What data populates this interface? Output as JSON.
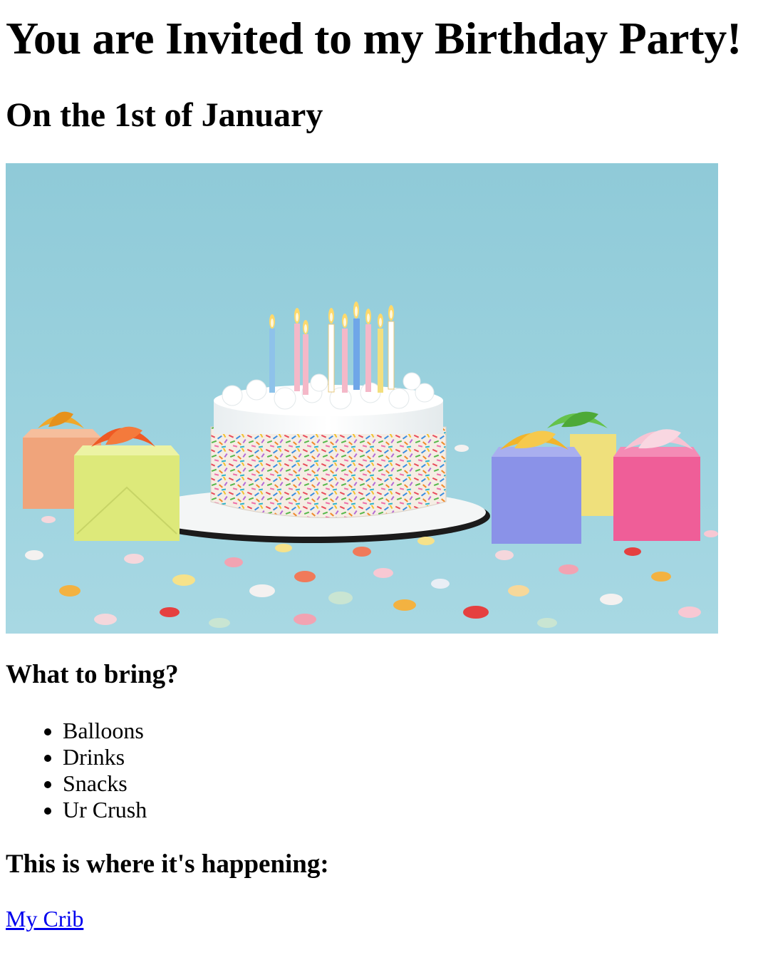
{
  "page": {
    "title": "You are Invited to my Birthday Party!",
    "subtitle": "On the 1st of January"
  },
  "image": {
    "alt": "Birthday cake with candles, gift boxes and confetti on a light blue background"
  },
  "bring": {
    "heading": "What to bring?",
    "items": [
      "Balloons",
      "Drinks",
      "Snacks",
      "Ur Crush"
    ]
  },
  "location": {
    "heading": "This is where it's happening:",
    "link_label": "My Crib"
  },
  "colors": {
    "link": "#0000ee",
    "background_blue": "#95cedb",
    "text": "#000000"
  }
}
